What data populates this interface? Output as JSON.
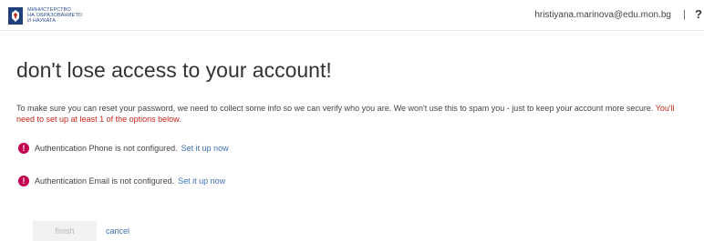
{
  "header": {
    "org_lines": [
      "МИНИСТЕРСТВО",
      "НА ОБРАЗОВАНИЕТО",
      "И НАУКАТА"
    ],
    "user_email": "hristiyana.marinova@edu.mon.bg",
    "separator": "|",
    "help_label": "?"
  },
  "main": {
    "title": "don't lose access to your account!",
    "intro": "To make sure you can reset your password, we need to collect some info so we can verify who you are. We won't use this to spam you - just to keep your account more secure.",
    "requirement": "You'll need to set up at least 1 of the options below.",
    "items": [
      {
        "icon": "!",
        "text": "Authentication Phone is not configured.",
        "link": "Set it up now"
      },
      {
        "icon": "!",
        "text": "Authentication Email is not configured.",
        "link": "Set it up now"
      }
    ]
  },
  "actions": {
    "finish_label": "finish",
    "cancel_label": "cancel"
  },
  "colors": {
    "link": "#3d6fb6",
    "warning_icon": "#c30052",
    "requirement_text": "#c7261b",
    "logo": "#1f3f7a"
  },
  "icons": {
    "logo": "ministry-crest-icon",
    "warning": "exclamation-circle-icon"
  }
}
